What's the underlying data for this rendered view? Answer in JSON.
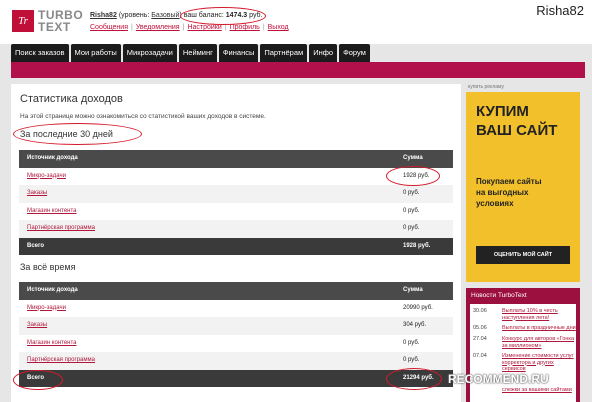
{
  "header": {
    "logo_letters": "Tr",
    "logo_line1": "TURBO",
    "logo_line2": "TEXT",
    "username": "Risha82",
    "level_prefix": "(уровень:",
    "level": "Базовый",
    "level_suffix": ")",
    "balance_label": "ваш баланс:",
    "balance": "1474.3",
    "balance_unit": "руб.",
    "links": [
      "Сообщения",
      "Уведомления",
      "Настройки",
      "Профиль",
      "Выход"
    ],
    "watermark_user": "Risha82"
  },
  "nav": [
    "Поиск заказов",
    "Мои работы",
    "Микрозадачи",
    "Нейминг",
    "Финансы",
    "Партнёрам",
    "Инфо",
    "Форум"
  ],
  "page": {
    "title": "Статистика доходов",
    "intro": "На этой странице можно ознакомиться со статистикой ваших доходов в системе."
  },
  "last30": {
    "title": "За последние 30 дней",
    "headers": [
      "Источник дохода",
      "Сумма"
    ],
    "rows": [
      {
        "source": "Микро-задачи",
        "sum": "1928 руб."
      },
      {
        "source": "Заказы",
        "sum": "0 руб."
      },
      {
        "source": "Магазин контента",
        "sum": "0 руб."
      },
      {
        "source": "Партнёрская программа",
        "sum": "0 руб."
      }
    ],
    "total_label": "Всего",
    "total": "1928 руб."
  },
  "alltime": {
    "title": "За всё время",
    "headers": [
      "Источник дохода",
      "Сумма"
    ],
    "rows": [
      {
        "source": "Микро-задачи",
        "sum": "20990 руб."
      },
      {
        "source": "Заказы",
        "sum": "304 руб."
      },
      {
        "source": "Магазин контента",
        "sum": "0 руб."
      },
      {
        "source": "Партнёрская программа",
        "sum": "0 руб."
      }
    ],
    "total_label": "Всего",
    "total": "21294 руб."
  },
  "ad": {
    "label": "купить рекламу",
    "title_line1": "КУПИМ",
    "title_line2": "ВАШ САЙТ",
    "sub_line1": "Покупаем сайты",
    "sub_line2": "на выгодных",
    "sub_line3": "условиях",
    "button": "ОЦЕНИТЬ МОЙ САЙТ"
  },
  "news": {
    "title": "Новости TurboText",
    "items": [
      {
        "date": "30.06",
        "text": "Выплаты 10% в честь наступления лета!"
      },
      {
        "date": "05.06",
        "text": "Выплаты в праздничные дни"
      },
      {
        "date": "27.04",
        "text": "Конкурс для авторов «Гонка за миллионом»"
      },
      {
        "date": "07.04",
        "text": "Изменение стоимости услуг корректора и других сервисов"
      },
      {
        "date": "",
        "text": "слежки за вашими сайтами"
      }
    ]
  },
  "watermark_site": "RECOMMEND.RU",
  "colors": {
    "brand": "#c0103a",
    "accent_bar": "#b2104a",
    "ad_bg": "#f1c02b",
    "table_head": "#4a4a4a"
  }
}
